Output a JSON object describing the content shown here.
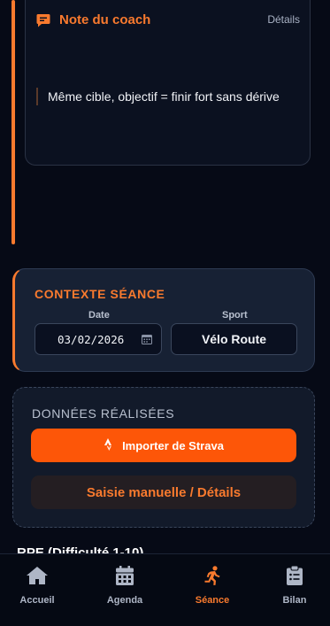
{
  "coach": {
    "title": "Note du coach",
    "details_link": "Détails",
    "note": "Même cible, objectif = finir fort sans dérive"
  },
  "context": {
    "title": "CONTEXTE SÉANCE",
    "date_label": "Date",
    "date_value": "03/02/2026",
    "sport_label": "Sport",
    "sport_value": "Vélo Route"
  },
  "data_section": {
    "title": "DONNÉES RÉALISÉES",
    "strava_button": "Importer de Strava",
    "manual_button": "Saisie manuelle / Détails"
  },
  "rpe": {
    "title": "RPE (Difficulté 1-10)"
  },
  "nav": {
    "items": [
      {
        "label": "Accueil",
        "icon": "home-icon"
      },
      {
        "label": "Agenda",
        "icon": "calendar-icon"
      },
      {
        "label": "Séance",
        "icon": "running-icon",
        "active": true
      },
      {
        "label": "Bilan",
        "icon": "clipboard-icon"
      }
    ]
  },
  "colors": {
    "accent": "#f97a2e",
    "strava": "#fd5608",
    "background": "#060a16"
  }
}
